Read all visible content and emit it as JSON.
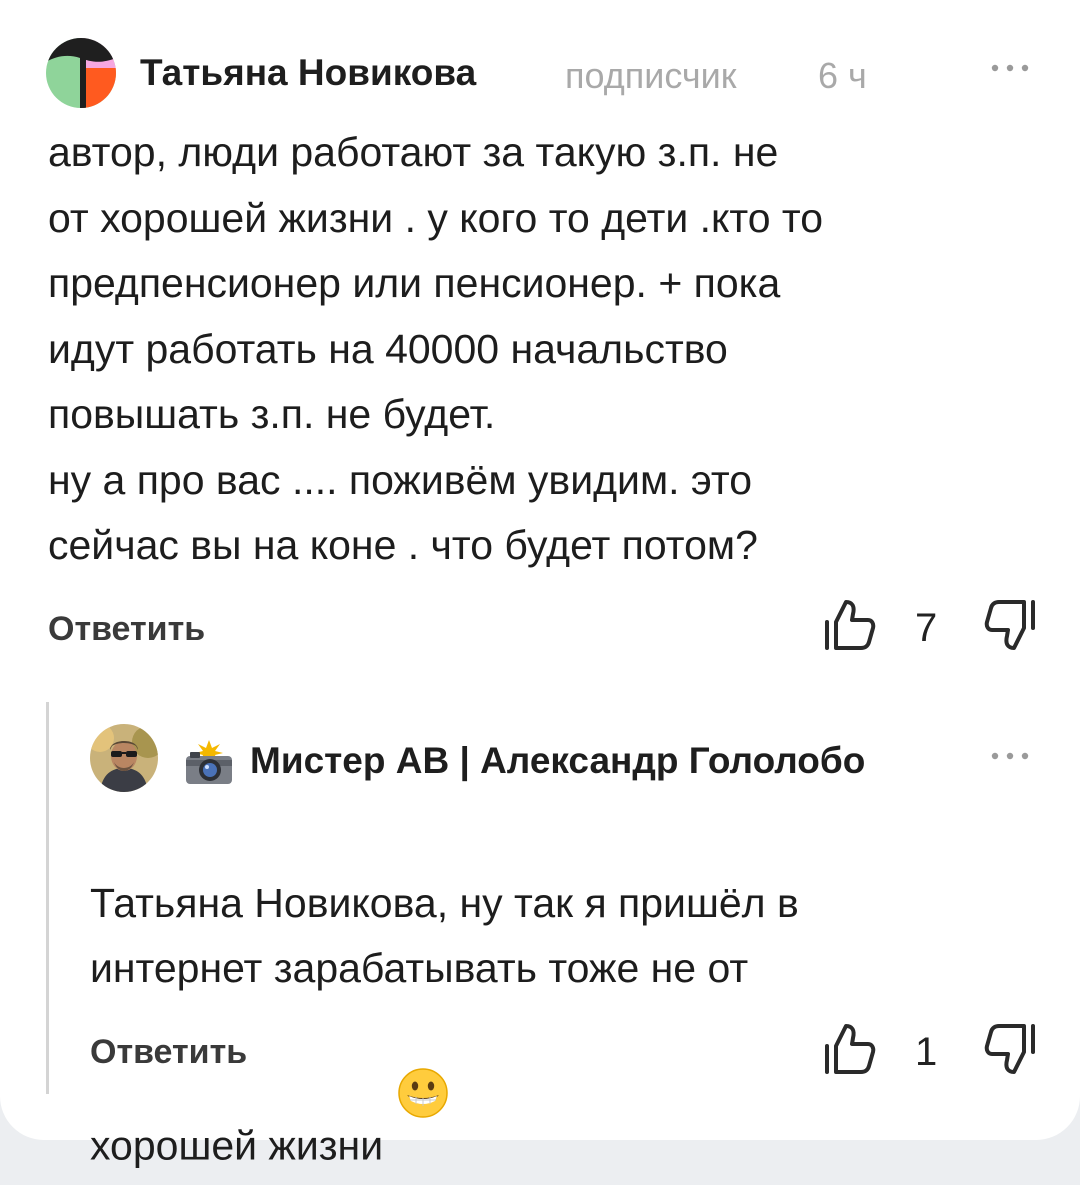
{
  "comments": [
    {
      "author": "Татьяна Новикова",
      "role": "подписчик",
      "time": "6 ч",
      "more_icon": "more-icon",
      "text": "автор,  люди работают за такую з.п.   не\nот хорошей жизни .  у кого то дети .кто то\nпредпенсионер или пенсионер. + пока\nидут работать на 40000   начальство\nповышать з.п. не будет.\nну а про вас .... поживём увидим. это\nсейчас вы на коне . что будет потом?",
      "reply_label": "Ответить",
      "likes": "7",
      "avatar_colors": [
        "#f6a7e0",
        "#8fd49a",
        "#ff5a1f",
        "#1f1f1f"
      ]
    },
    {
      "author": "Мистер АВ | Александр Гололобо",
      "author_badge_icon": "camera-flash-icon",
      "more_icon": "more-icon",
      "text": "Татьяна Новикова, ну так я пришёл в\nинтернет зарабатывать тоже не от\nхорошей жизни",
      "text_emoji_icon": "grinning-face-icon",
      "reply_label": "Ответить",
      "likes": "1"
    }
  ],
  "colors": {
    "background": "#eceef1",
    "card": "#ffffff",
    "muted_text": "#a9a9a9",
    "thread_line": "#d4d4d4"
  }
}
